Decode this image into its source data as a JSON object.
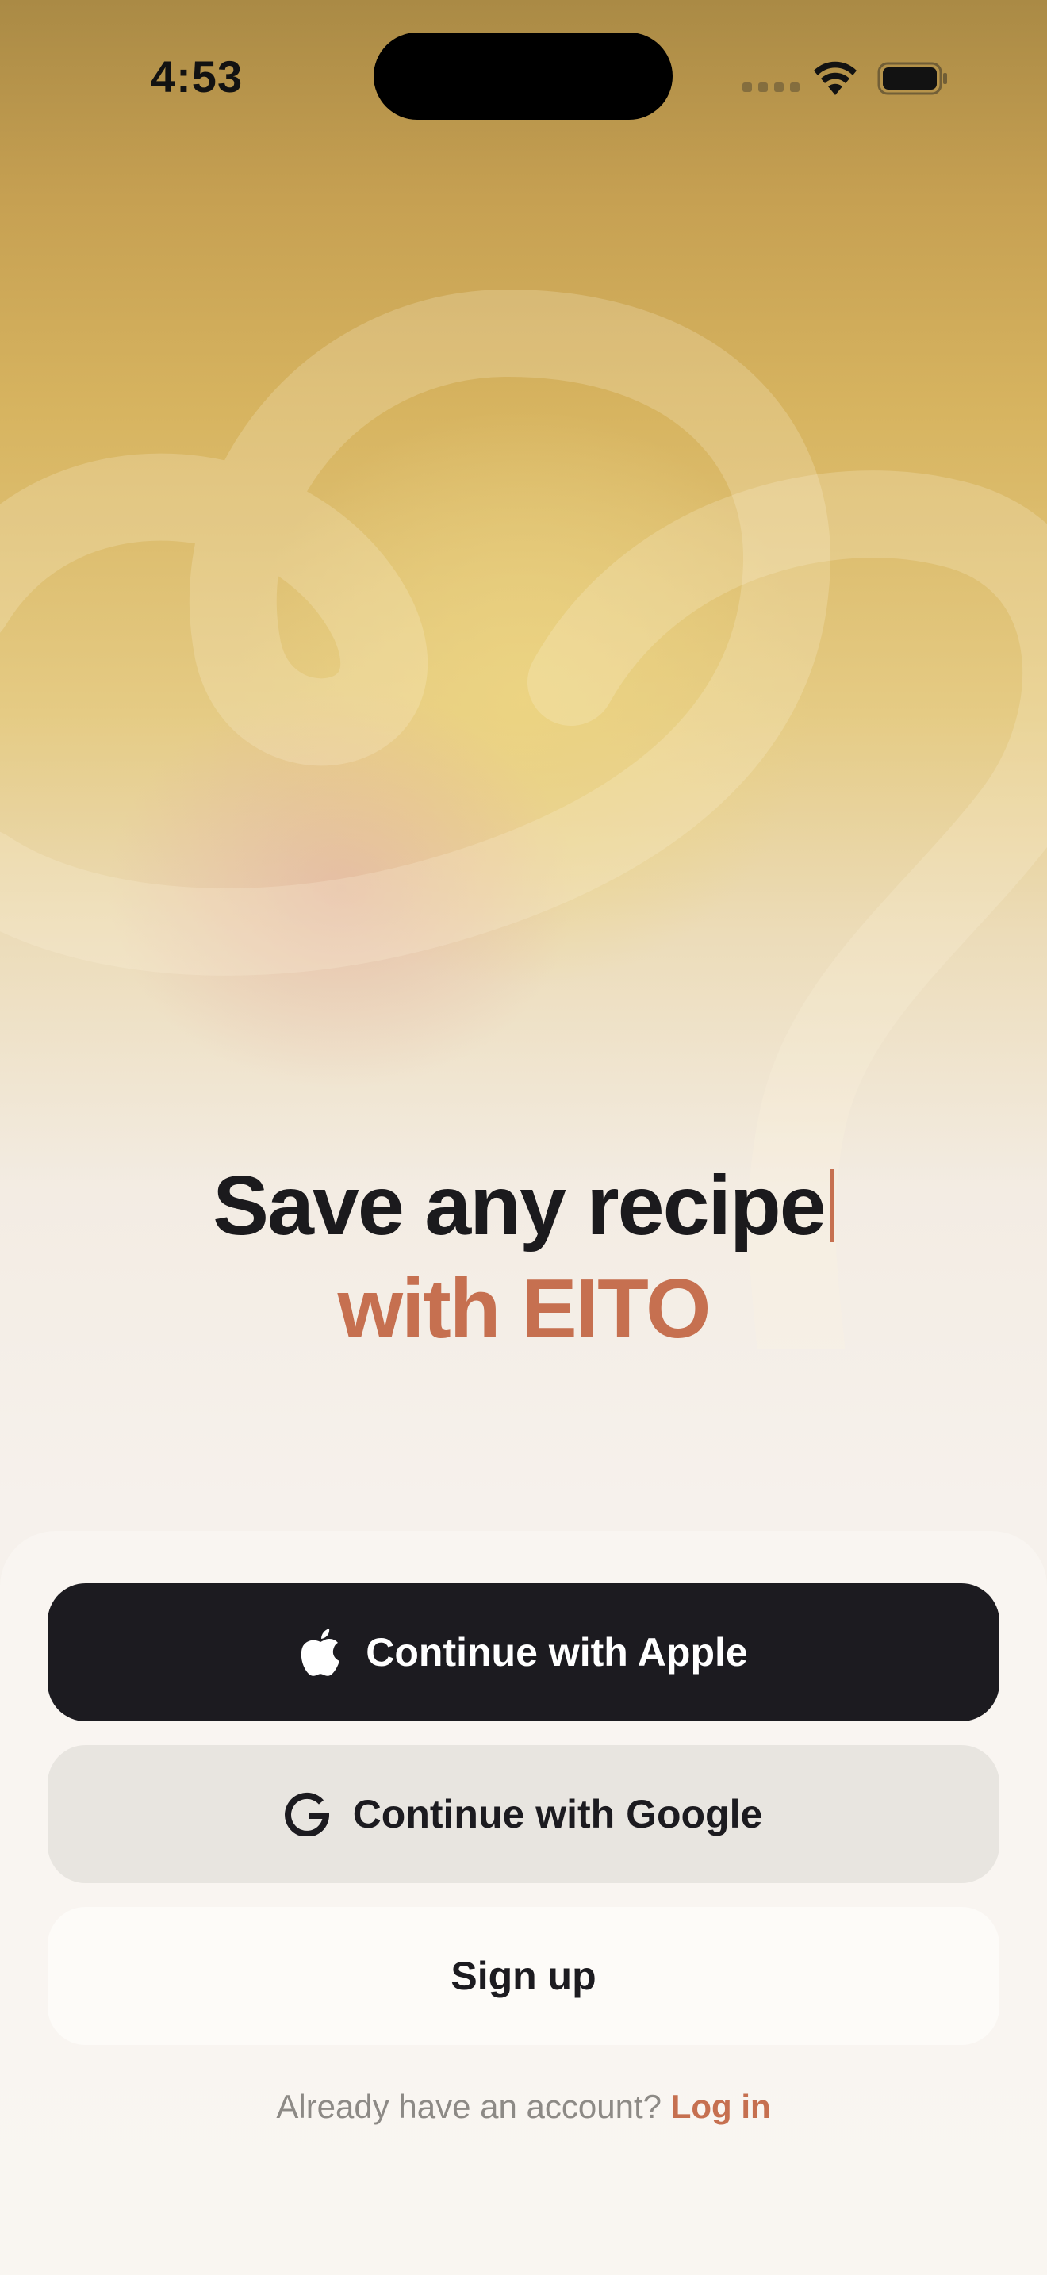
{
  "status_bar": {
    "time": "4:53"
  },
  "headline": {
    "line1": "Save any recipe",
    "line2": "with EITO"
  },
  "auth": {
    "apple_label": "Continue with Apple",
    "google_label": "Continue with Google",
    "signup_label": "Sign up"
  },
  "footer": {
    "prompt": "Already have an account?",
    "login_label": "Log in"
  },
  "icons": {
    "apple": "apple-icon",
    "google": "google-icon",
    "wifi": "wifi-icon",
    "battery": "battery-icon"
  },
  "colors": {
    "accent": "#c67050",
    "dark_button": "#1c1b20",
    "google_button": "#e8e5e0",
    "signup_button": "#fdfbf8"
  }
}
